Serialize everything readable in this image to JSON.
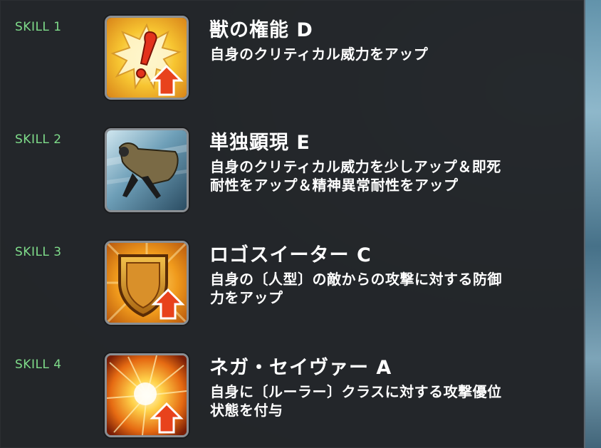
{
  "skills": [
    {
      "label": "SKILL 1",
      "title": "獣の権能 D",
      "desc_lines": [
        "自身のクリティカル威力をアップ"
      ],
      "icon": "exclamation-burst-up-arrow-icon"
    },
    {
      "label": "SKILL 2",
      "title": "単独顕現 E",
      "desc_lines": [
        "自身のクリティカル威力を少しアップ＆即死",
        "耐性をアップ＆精神異常耐性をアップ"
      ],
      "icon": "cloaked-figure-icon"
    },
    {
      "label": "SKILL 3",
      "title": "ロゴスイーター C",
      "desc_lines": [
        "自身の〔人型〕の敵からの攻撃に対する防御",
        "力をアップ"
      ],
      "icon": "shield-up-arrow-icon"
    },
    {
      "label": "SKILL 4",
      "title": "ネガ・セイヴァー A",
      "desc_lines": [
        "自身に〔ルーラー〕クラスに対する攻撃優位",
        "状態を付与"
      ],
      "icon": "explosion-up-arrow-icon"
    }
  ],
  "colors": {
    "skill_label": "#7fdc8a",
    "text": "#ffffff",
    "panel": "#242629",
    "arrow": "#e8421c"
  }
}
